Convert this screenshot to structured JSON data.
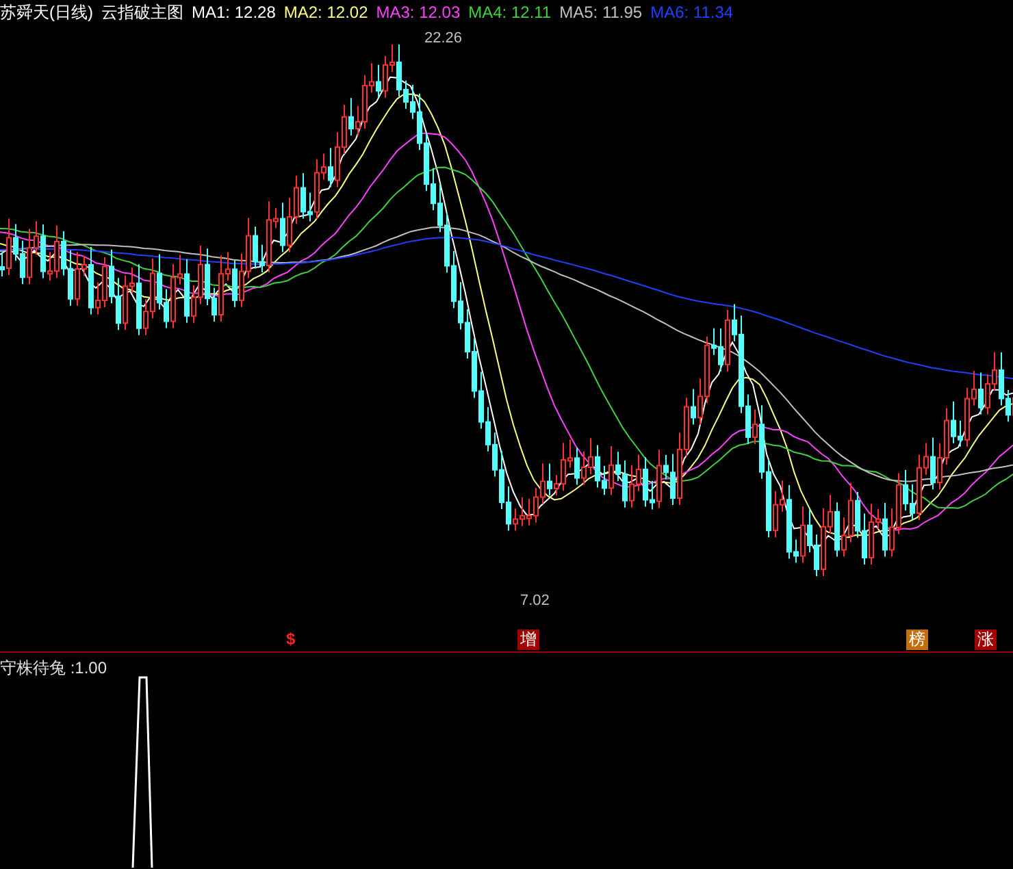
{
  "title": "苏舜天(日线)",
  "indicator": "云指破主图",
  "ma_readings": [
    {
      "label": "MA1:",
      "value": "12.28",
      "color": "#ffffff"
    },
    {
      "label": "MA2:",
      "value": "12.02",
      "color": "#ffff80"
    },
    {
      "label": "MA3:",
      "value": "12.03",
      "color": "#ff40ff"
    },
    {
      "label": "MA4:",
      "value": "12.11",
      "color": "#40d040"
    },
    {
      "label": "MA5:",
      "value": "11.95",
      "color": "#c0c0c0"
    },
    {
      "label": "MA6:",
      "value": "11.34",
      "color": "#2040ff"
    }
  ],
  "high_label": "22.26",
  "low_label": "7.02",
  "markers": [
    {
      "text": "$",
      "kind": "plain",
      "color": "#ff2020"
    },
    {
      "text": "增",
      "kind": "boxed",
      "color": "#a00000"
    },
    {
      "text": "榜",
      "kind": "boxed",
      "color": "#c07010"
    },
    {
      "text": "涨",
      "kind": "boxed",
      "color": "#a00000"
    }
  ],
  "sub_panel": {
    "text": "守株待兔 :1.00"
  }
}
